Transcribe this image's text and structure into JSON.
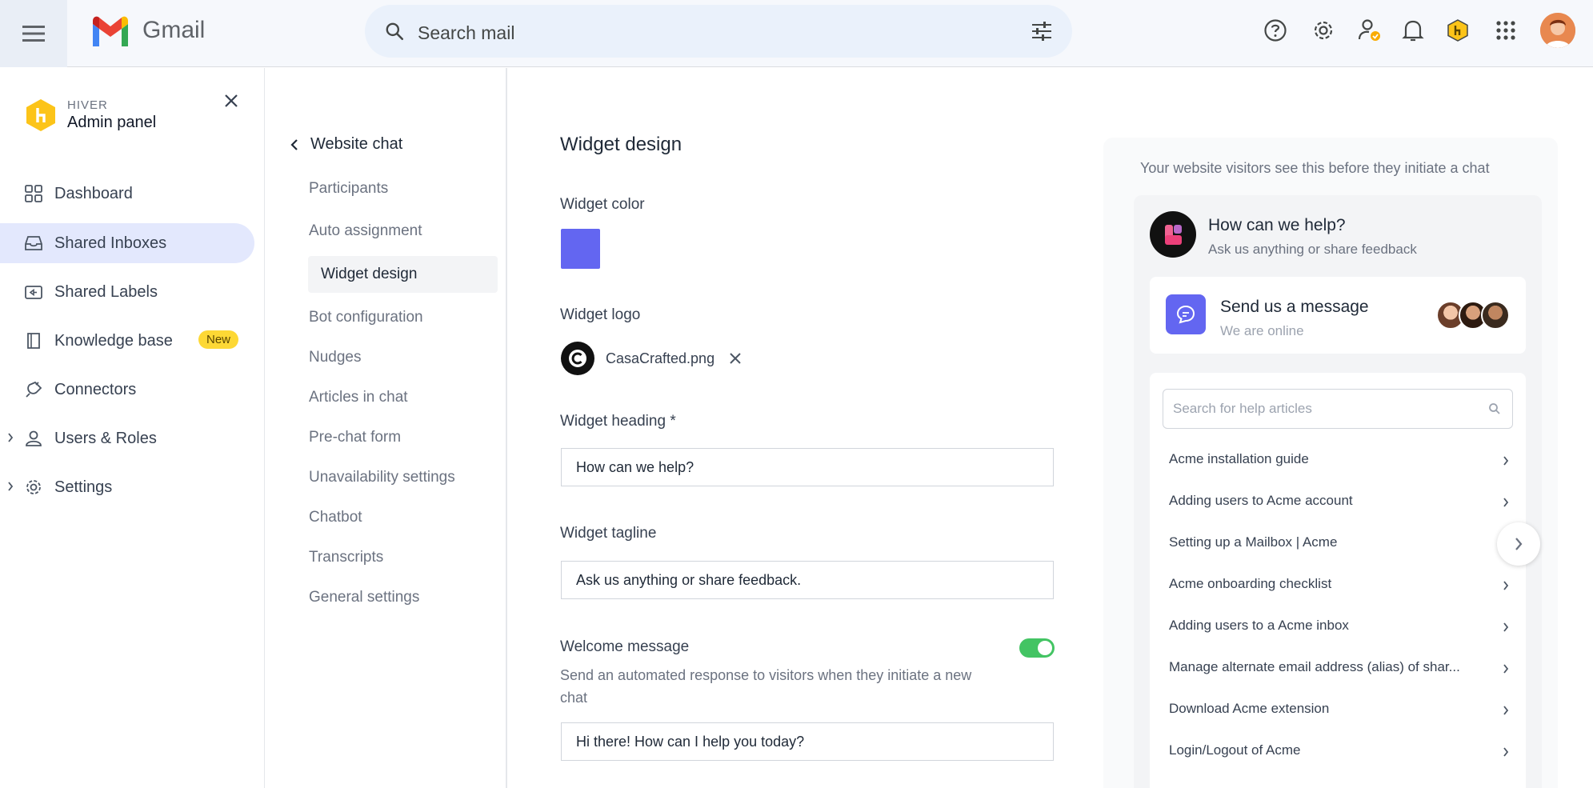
{
  "gmail": {
    "app_name": "Gmail",
    "search_placeholder": "Search mail"
  },
  "sidebar": {
    "brand_small": "HIVER",
    "brand_title": "Admin panel",
    "items": [
      {
        "label": "Dashboard"
      },
      {
        "label": "Shared Inboxes",
        "active": true
      },
      {
        "label": "Shared Labels"
      },
      {
        "label": "Knowledge base",
        "badge": "New"
      },
      {
        "label": "Connectors"
      },
      {
        "label": "Users & Roles"
      },
      {
        "label": "Settings"
      }
    ]
  },
  "subnav": {
    "title": "Website chat",
    "items": [
      {
        "label": "Participants"
      },
      {
        "label": "Auto assignment"
      },
      {
        "label": "Widget design",
        "active": true
      },
      {
        "label": "Bot configuration"
      },
      {
        "label": "Nudges"
      },
      {
        "label": "Articles in chat"
      },
      {
        "label": "Pre-chat form"
      },
      {
        "label": "Unavailability settings"
      },
      {
        "label": "Chatbot"
      },
      {
        "label": "Transcripts"
      },
      {
        "label": "General settings"
      }
    ]
  },
  "form": {
    "title": "Widget design",
    "color_label": "Widget color",
    "color_value": "#6366f1",
    "logo_label": "Widget logo",
    "logo_file": "CasaCrafted.png",
    "heading_label": "Widget heading *",
    "heading_value": "How can we help?",
    "tagline_label": "Widget tagline",
    "tagline_value": "Ask us anything or share feedback.",
    "welcome_label": "Welcome message",
    "welcome_enabled": true,
    "welcome_help": "Send an automated response to visitors when they initiate a new chat",
    "welcome_value": "Hi there! How can I help you today?"
  },
  "preview": {
    "caption": "Your website visitors see this before they initiate a chat",
    "heading": "How can we help?",
    "tagline": "Ask us anything or share feedback",
    "message_title": "Send us a message",
    "message_sub": "We are online",
    "search_placeholder": "Search for help articles",
    "articles": [
      "Acme installation guide",
      "Adding users to Acme account",
      "Setting up a Mailbox | Acme",
      "Acme onboarding checklist",
      "Adding users to a Acme inbox",
      "Manage alternate email address (alias) of shar...",
      "Download Acme extension",
      "Login/Logout of Acme"
    ]
  },
  "colors": {
    "accent": "#6366f1",
    "active_nav": "#e3e8fd",
    "badge": "#fdd835",
    "toggle_on": "#43c463",
    "hiver_yellow": "#fcc419"
  }
}
